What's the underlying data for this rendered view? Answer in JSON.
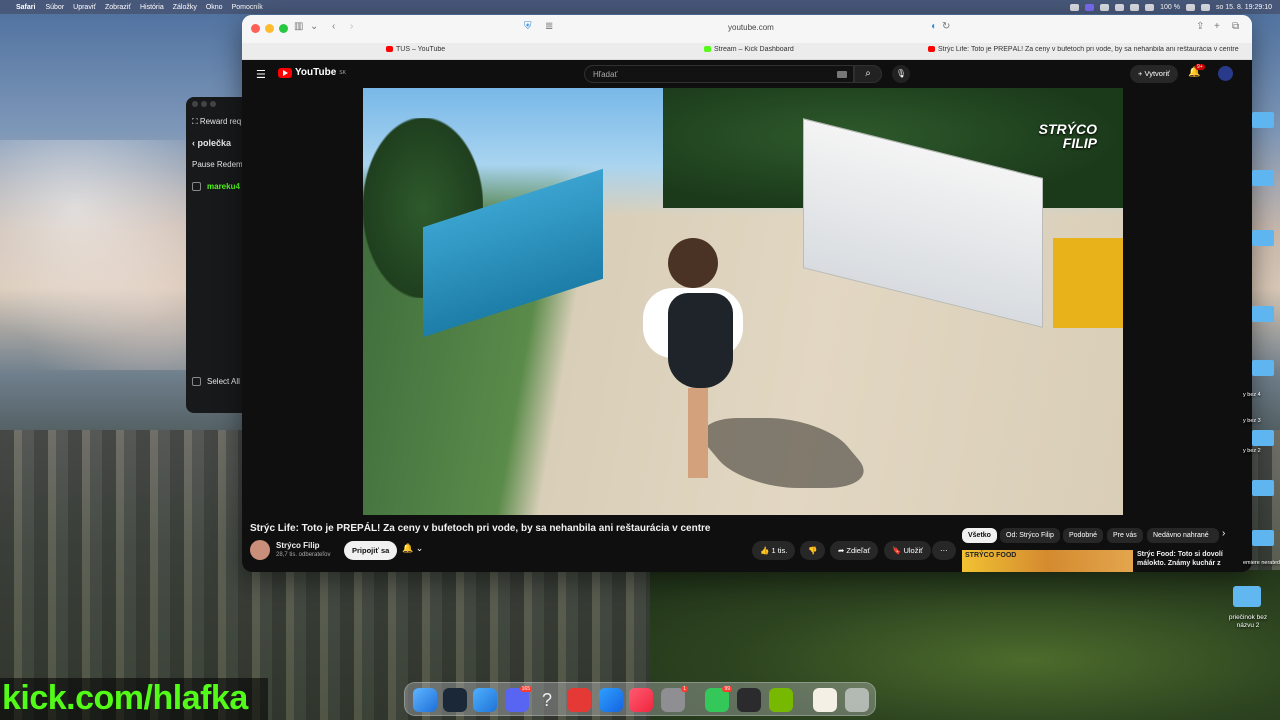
{
  "menubar": {
    "app": "Safari",
    "items": [
      "Súbor",
      "Upraviť",
      "Zobraziť",
      "História",
      "Záložky",
      "Okno",
      "Pomocník"
    ],
    "battery": "100 %",
    "clock": "so 15. 8.  19:29:10"
  },
  "kick_window": {
    "title": "Reward req",
    "back_label": "polečka",
    "pause": "Pause Redem",
    "item": "mareku4",
    "select_all": "Select All"
  },
  "browser": {
    "url": "youtube.com",
    "tabs": [
      {
        "label": "TUŠ – YouTube",
        "fav_color": "#ff0000"
      },
      {
        "label": "Stream – Kick Dashboard",
        "fav_color": "#53fc18"
      },
      {
        "label": "Strýc Life: Toto je PREPÁL! Za ceny v bufetoch pri vode, by sa nehanbila ani reštaurácia v centre",
        "fav_color": "#ff0000"
      }
    ]
  },
  "youtube": {
    "logo": "YouTube",
    "region": "SK",
    "search_placeholder": "Hľadať",
    "create_label": "Vytvoriť",
    "notif_badge": "9+",
    "video": {
      "watermark_line1": "STRÝCO",
      "watermark_line2": "FILIP",
      "title": "Strýc Life: Toto je PREPÁL! Za ceny v bufetoch pri vode, by sa nehanbila ani reštaurácia v centre"
    },
    "channel": {
      "name": "Strýco Filip",
      "subs": "28,7 tis. odberateľov",
      "subscribe_label": "Pripojiť sa"
    },
    "actions": {
      "likes": "1 tis.",
      "share": "Zdieľať",
      "save": "Uložiť"
    },
    "chips": [
      "Všetko",
      "Od: Strýco Filip",
      "Podobné",
      "Pre vás",
      "Nedávno nahrané"
    ],
    "recommendation": {
      "thumb_label": "STRÝCO FOOD",
      "title": "Strýc Food: Toto si dovolí málokto. Známy kuchár z"
    }
  },
  "desktop": {
    "folder_label": "priečinok bez názvu 2",
    "side_labels": [
      "y bez 4",
      "y bez 3",
      "y bez 2",
      "emiere nerated"
    ]
  },
  "overlay": {
    "kick_url": "kick.com/hlafka"
  },
  "dock": {
    "steam_badge": "",
    "discord_badge": "165",
    "settings_badge": "1",
    "messages_badge": "99"
  }
}
